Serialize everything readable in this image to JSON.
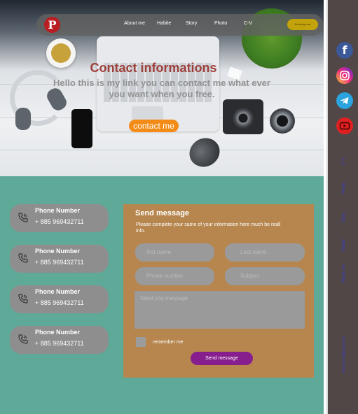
{
  "nav": {
    "logo_icon": "pinterest-icon",
    "links": [
      "About me",
      "Habite",
      "Story",
      "Photo",
      "C-V"
    ],
    "button_label": "Booking now"
  },
  "hero": {
    "title": "Contact informations",
    "subtitle": "Hello this is my link you can contact me what ever you want when you free.",
    "button_label": "contact me"
  },
  "contact_cards": [
    {
      "label": "Phone Number",
      "number": "+ 885 969432711"
    },
    {
      "label": "Phone Number",
      "number": "+ 885 969432711"
    },
    {
      "label": "Phone Number",
      "number": "+ 885 969432711"
    },
    {
      "label": "Phone Number",
      "number": "+ 885 969432711"
    }
  ],
  "form": {
    "title": "Send message",
    "description": "Please complete your same of your information here much be reall info.",
    "first_name_placeholder": "first name",
    "last_name_placeholder": "Last name",
    "phone_placeholder": "Phone number",
    "subject_placeholder": "Subject",
    "message_placeholder": "Send you message",
    "remember_label": "remember me",
    "submit_label": "Send message"
  },
  "sidebar": {
    "social": [
      {
        "icon": "facebook-icon",
        "color": "#3b5998"
      },
      {
        "icon": "instagram-icon",
        "color": "#d6249f"
      },
      {
        "icon": "telegram-icon",
        "color": "#2aa3df"
      },
      {
        "icon": "youtube-icon",
        "color": "#e02020"
      }
    ],
    "links": [
      "C-V",
      "Photo",
      "Story",
      "Habite",
      "About me"
    ],
    "email": "theara.ichiti@gmail.com"
  },
  "colors": {
    "section_bg": "#5fa998",
    "form_bg": "#b6864e",
    "card_bg": "#8e8e8e",
    "accent_orange": "#f38b16",
    "submit_purple": "#861e8e",
    "panel_bg": "#514747",
    "title_red": "#9e3f3a"
  }
}
